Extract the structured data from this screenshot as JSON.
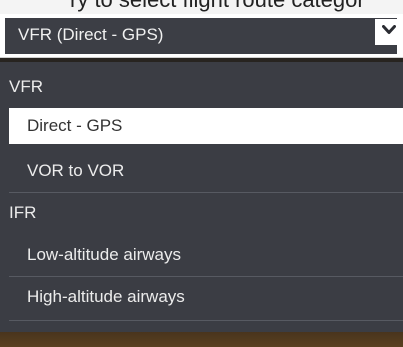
{
  "header_fragment": "ry to select flight route categor",
  "select": {
    "value": "VFR (Direct - GPS)",
    "icon": "chevron-down-icon"
  },
  "groups": [
    {
      "label": "VFR",
      "options": [
        {
          "label": "Direct - GPS",
          "selected": true
        },
        {
          "label": "VOR to VOR",
          "selected": false
        }
      ]
    },
    {
      "label": "IFR",
      "options": [
        {
          "label": "Low-altitude airways",
          "selected": false
        },
        {
          "label": "High-altitude airways",
          "selected": false
        }
      ]
    }
  ],
  "colors": {
    "panel": "#3b3d44",
    "selected_bg": "#ffffff",
    "text": "#ececec"
  }
}
